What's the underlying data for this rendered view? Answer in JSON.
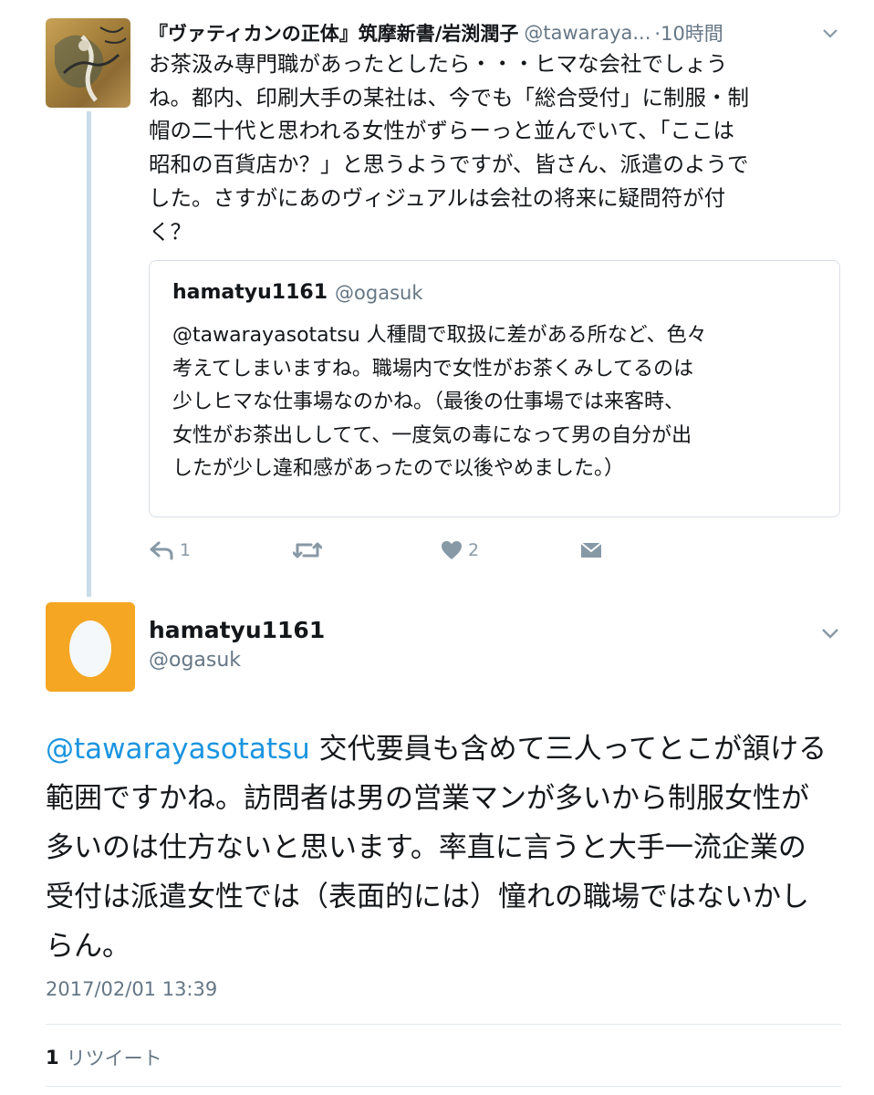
{
  "parent_tweet": {
    "author_name": "『ヴァティカンの正体』筑摩新書/岩渕潤子",
    "handle": "@tawaraya...",
    "time": "·10時間",
    "text": "お茶汲み専門職があったとしたら・・・ヒマな会社でしょう\nね。都内、印刷大手の某社は、今でも「総合受付」に制服・制\n帽の二十代と思われる女性がずらーっと並んでいて、「ここは\n昭和の百貨店か？」と思うようですが、皆さん、派遣のようで\nした。さすがにあのヴィジュアルは会社の将来に疑問符が付\nく？",
    "quote": {
      "author_name": "hamatyu1161",
      "handle": "@ogasuk",
      "text": "@tawarayasotatsu 人種間で取扱に差がある所など、色々\n考えてしまいますね。職場内で女性がお茶くみしてるのは\n少しヒマな仕事場なのかね。（最後の仕事場では来客時、\n女性がお茶出ししてて、一度気の毒になって男の自分が出\nしたが少し違和感があったので以後やめました。）"
    },
    "actions": {
      "reply_count": "1",
      "like_count": "2"
    }
  },
  "main_tweet": {
    "author_name": "hamatyu1161",
    "handle": "@ogasuk",
    "mention": "@tawarayasotatsu",
    "text": " 交代要員も含めて三人ってとこが頷ける範囲ですかね。訪問者は男の営業マンが多いから制服女性が多いのは仕方ないと思います。率直に言うと大手一流企業の受付は派遣女性では（表面的には）憧れの職場ではないかしらん。",
    "timestamp": "2017/02/01 13:39",
    "retweet_count": "1",
    "retweet_label": "リツイート"
  },
  "colors": {
    "link": "#1b95e0",
    "secondary_text": "#657786",
    "thread_line": "#c9dcea",
    "egg_avatar_bg": "#f5a623"
  }
}
